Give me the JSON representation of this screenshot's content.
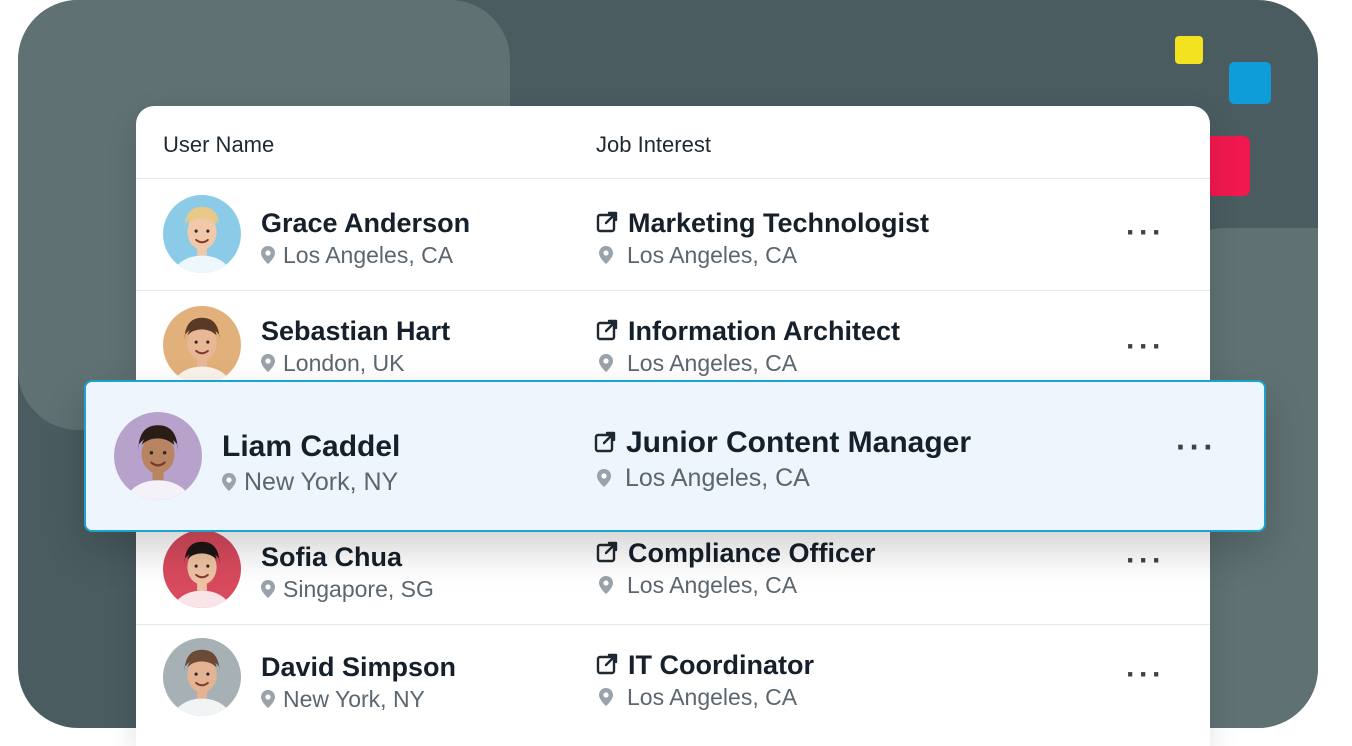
{
  "table": {
    "header": {
      "user": "User Name",
      "job": "Job Interest"
    },
    "rows": [
      {
        "name": "Grace Anderson",
        "location": "Los Angeles, CA",
        "job": "Marketing Technologist",
        "job_location": "Los Angeles, CA",
        "more": "···",
        "avatar_bg": "#8ccbe8",
        "avatar_skin": "#f2c9a8",
        "avatar_hair": "#e8c98a"
      },
      {
        "name": "Sebastian Hart",
        "location": "London, UK",
        "job": "Information Architect",
        "job_location": "Los Angeles, CA",
        "more": "···",
        "avatar_bg": "#e2b07a",
        "avatar_skin": "#e8b896",
        "avatar_hair": "#5a3a26"
      },
      {
        "name": "Liam Caddel",
        "location": "New York, NY",
        "job": "Junior Content Manager",
        "job_location": "Los Angeles, CA",
        "more": "···",
        "avatar_bg": "#b7a2cc",
        "avatar_skin": "#b88462",
        "avatar_hair": "#2a1c16"
      },
      {
        "name": "Sofia Chua",
        "location": "Singapore, SG",
        "job": "Compliance Officer",
        "job_location": "Los Angeles, CA",
        "more": "···",
        "avatar_bg": "#d84a5e",
        "avatar_skin": "#efc2a3",
        "avatar_hair": "#1e1614"
      },
      {
        "name": "David Simpson",
        "location": "New York, NY",
        "job": "IT Coordinator",
        "job_location": "Los Angeles, CA",
        "more": "···",
        "avatar_bg": "#a7b1b5",
        "avatar_skin": "#e3b394",
        "avatar_hair": "#6b4b36"
      }
    ]
  },
  "colors": {
    "yellow": "#f2e21f",
    "blue": "#0f9dd9",
    "red": "#f0184e",
    "highlight_border": "#1aa3cc"
  },
  "icons": {
    "location": "map-pin-icon",
    "job": "external-link-icon",
    "more": "more-horizontal-icon"
  }
}
